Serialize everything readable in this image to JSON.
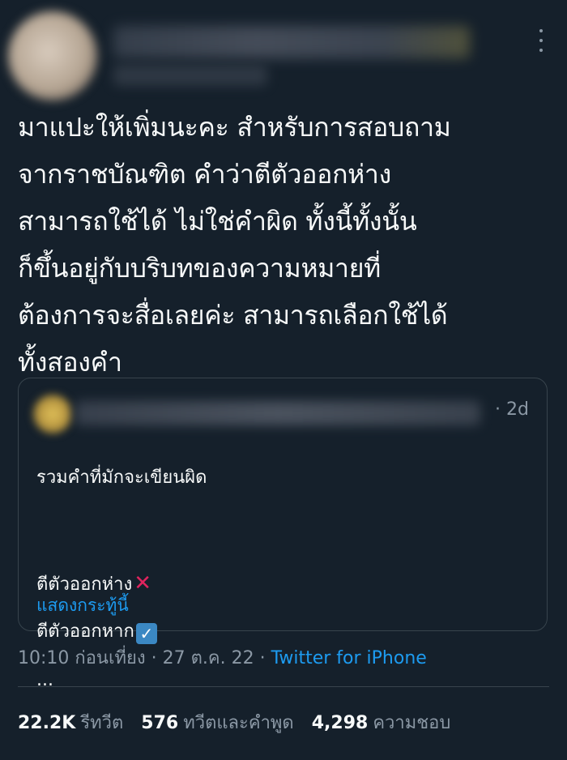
{
  "tweet": {
    "more_icon": "more-vertical-icon",
    "text": "มาแปะให้เพิ่มนะคะ สำหรับการสอบถาม\nจากราชบัณฑิต คำว่าตีตัวออกห่าง\nสามารถใช้ได้ ไม่ใช่คำผิด ทั้งนี้ทั้งนั้น\nก็ขึ้นอยู่กับบริบทของความหมายที่\nต้องการจะสื่อเลยค่ะ สามารถเลือกใช้ได้\nทั้งสองคำ"
  },
  "quote": {
    "time": "· 2d",
    "line1": "รวมคำที่มักจะเขียนผิด",
    "line2": "ตีตัวออกห่าง",
    "line2_icon": "cross-mark-icon",
    "line3": "ตีตัวออกหาก",
    "line3_icon": "check-mark-icon",
    "ellipsis": "...",
    "show_more": "แสดงกระทู้นี้"
  },
  "meta": {
    "time": "10:10 ก่อนเที่ยง",
    "sep1": " · ",
    "date": "27 ต.ค. 22",
    "sep2": " · ",
    "source": "Twitter for iPhone"
  },
  "stats": {
    "retweets": "22.2K",
    "retweets_label": "รีทวีต",
    "quotes": "576",
    "quotes_label": "ทวีตและคำพูด",
    "likes": "4,298",
    "likes_label": "ความชอบ"
  },
  "colors": {
    "background": "#15202b",
    "link": "#1d9bf0",
    "secondary_text": "#8b98a5",
    "border": "#38444d"
  }
}
